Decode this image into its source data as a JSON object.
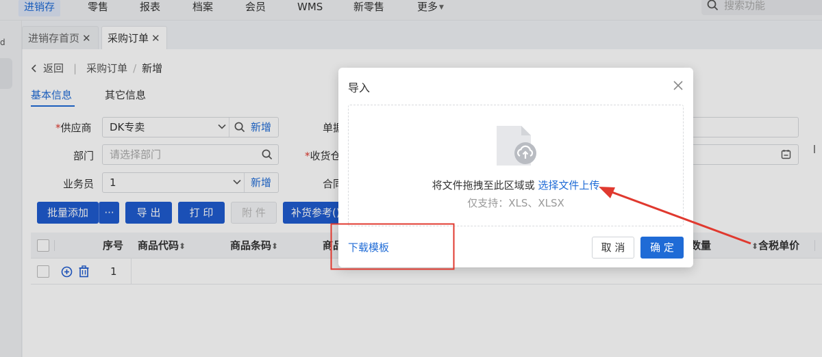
{
  "topnav": {
    "items": [
      "进销存",
      "零售",
      "报表",
      "档案",
      "会员",
      "WMS",
      "新零售",
      "更多"
    ],
    "search_placeholder": "搜索功能"
  },
  "leftstrip": {
    "glyph": "d"
  },
  "page_tabs": [
    {
      "label": "进销存首页",
      "close": "✕"
    },
    {
      "label": "采购订单",
      "close": "✕"
    }
  ],
  "breadcrumb": {
    "back": "返回",
    "parent": "采购订单",
    "sep": "/",
    "current": "新增"
  },
  "sub_tabs": [
    "基本信息",
    "其它信息"
  ],
  "form": {
    "supplier_label": "供应商",
    "supplier_value": "DK专卖",
    "supplier_add": "新增",
    "department_label": "部门",
    "department_placeholder": "请选择部门",
    "salesman_label": "业务员",
    "salesman_value": "1",
    "salesman_add": "新增",
    "doc_label_partial": "单据",
    "warehouse_label_partial": "收货仓",
    "contract_label_partial": "合同"
  },
  "toolbar": {
    "batch_add": "批量添加",
    "more": "···",
    "export": "导 出",
    "print": "打 印",
    "attach": "附 件",
    "replenish": "补货参考()"
  },
  "table": {
    "headers": [
      "序号",
      "商品代码",
      "商品条码",
      "商品",
      "数量",
      "含税单价"
    ],
    "rows": [
      {
        "index": "1"
      }
    ]
  },
  "modal": {
    "title": "导入",
    "drop_text": "将文件拖拽至此区域或",
    "select_link": "选择文件上传",
    "support_text": "仅支持：XLS、XLSX",
    "download_template": "下载模板",
    "cancel": "取 消",
    "ok": "确 定"
  },
  "colors": {
    "primary": "#1f6bd6",
    "button_blue": "#1f5cd0",
    "required": "#e0392f",
    "annotation_red": "#e0392f"
  }
}
